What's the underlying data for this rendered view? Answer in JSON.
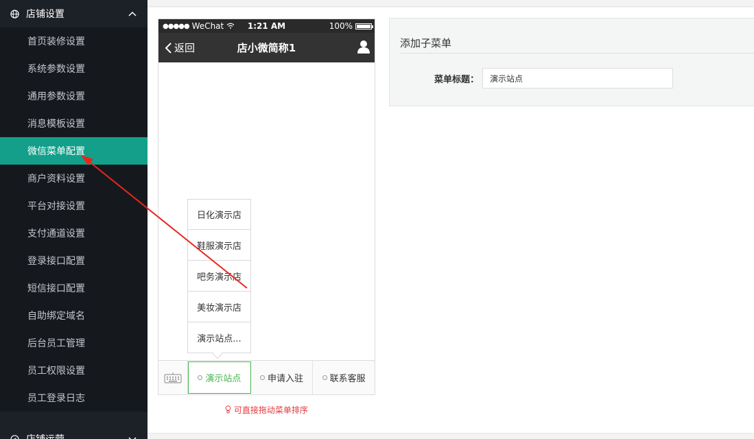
{
  "sidebar": {
    "group_title": "店铺设置",
    "items": [
      {
        "label": "首页装修设置"
      },
      {
        "label": "系统参数设置"
      },
      {
        "label": "通用参数设置"
      },
      {
        "label": "消息模板设置"
      },
      {
        "label": "微信菜单配置"
      },
      {
        "label": "商户资料设置"
      },
      {
        "label": "平台对接设置"
      },
      {
        "label": "支付通道设置"
      },
      {
        "label": "登录接口配置"
      },
      {
        "label": "短信接口配置"
      },
      {
        "label": "自助绑定域名"
      },
      {
        "label": "后台员工管理"
      },
      {
        "label": "员工权限设置"
      },
      {
        "label": "员工登录日志"
      }
    ],
    "active_index": 4,
    "next_group_title": "店铺运营"
  },
  "phone": {
    "carrier": "WeChat",
    "time": "1:21 AM",
    "battery": "100%",
    "back_label": "返回",
    "title": "店小微简称1",
    "submenu": [
      "日化演示店",
      "鞋服演示店",
      "吧务演示店",
      "美妆演示店",
      "演示站点..."
    ],
    "menubar": [
      {
        "label": "演示站点",
        "selected": true
      },
      {
        "label": "申请入驻",
        "selected": false
      },
      {
        "label": "联系客服",
        "selected": false
      }
    ],
    "hint": "可直接拖动菜单排序"
  },
  "panel": {
    "title": "添加子菜单",
    "field_label": "菜单标题：",
    "field_value": "演示站点"
  },
  "colors": {
    "sidebar_bg": "#1c2027",
    "active": "#139f8a",
    "selected_green": "#44b549",
    "hint_red": "#e4393c",
    "annotation": "#e8261c"
  }
}
